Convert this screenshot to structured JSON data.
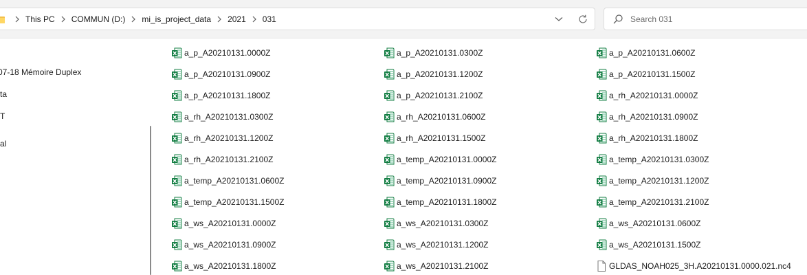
{
  "breadcrumb": {
    "items": [
      "This PC",
      "COMMUN (D:)",
      "mi_is_project_data",
      "2021",
      "031"
    ]
  },
  "search": {
    "placeholder": "Search 031"
  },
  "navpane": {
    "items": [
      "07-18 Mémoire Duplex",
      "ta",
      "T",
      "al"
    ]
  },
  "files": [
    {
      "name": "a_p_A20210131.0000Z",
      "type": "excel"
    },
    {
      "name": "a_p_A20210131.0300Z",
      "type": "excel"
    },
    {
      "name": "a_p_A20210131.0600Z",
      "type": "excel"
    },
    {
      "name": "a_p_A20210131.0900Z",
      "type": "excel"
    },
    {
      "name": "a_p_A20210131.1200Z",
      "type": "excel"
    },
    {
      "name": "a_p_A20210131.1500Z",
      "type": "excel"
    },
    {
      "name": "a_p_A20210131.1800Z",
      "type": "excel"
    },
    {
      "name": "a_p_A20210131.2100Z",
      "type": "excel"
    },
    {
      "name": "a_rh_A20210131.0000Z",
      "type": "excel"
    },
    {
      "name": "a_rh_A20210131.0300Z",
      "type": "excel"
    },
    {
      "name": "a_rh_A20210131.0600Z",
      "type": "excel"
    },
    {
      "name": "a_rh_A20210131.0900Z",
      "type": "excel"
    },
    {
      "name": "a_rh_A20210131.1200Z",
      "type": "excel"
    },
    {
      "name": "a_rh_A20210131.1500Z",
      "type": "excel"
    },
    {
      "name": "a_rh_A20210131.1800Z",
      "type": "excel"
    },
    {
      "name": "a_rh_A20210131.2100Z",
      "type": "excel"
    },
    {
      "name": "a_temp_A20210131.0000Z",
      "type": "excel"
    },
    {
      "name": "a_temp_A20210131.0300Z",
      "type": "excel"
    },
    {
      "name": "a_temp_A20210131.0600Z",
      "type": "excel"
    },
    {
      "name": "a_temp_A20210131.0900Z",
      "type": "excel"
    },
    {
      "name": "a_temp_A20210131.1200Z",
      "type": "excel"
    },
    {
      "name": "a_temp_A20210131.1500Z",
      "type": "excel"
    },
    {
      "name": "a_temp_A20210131.1800Z",
      "type": "excel"
    },
    {
      "name": "a_temp_A20210131.2100Z",
      "type": "excel"
    },
    {
      "name": "a_ws_A20210131.0000Z",
      "type": "excel"
    },
    {
      "name": "a_ws_A20210131.0300Z",
      "type": "excel"
    },
    {
      "name": "a_ws_A20210131.0600Z",
      "type": "excel"
    },
    {
      "name": "a_ws_A20210131.0900Z",
      "type": "excel"
    },
    {
      "name": "a_ws_A20210131.1200Z",
      "type": "excel"
    },
    {
      "name": "a_ws_A20210131.1500Z",
      "type": "excel"
    },
    {
      "name": "a_ws_A20210131.1800Z",
      "type": "excel"
    },
    {
      "name": "a_ws_A20210131.2100Z",
      "type": "excel"
    },
    {
      "name": "GLDAS_NOAH025_3H.A20210131.0000.021.nc4",
      "type": "generic"
    }
  ],
  "colors": {
    "excel_green": "#107c41",
    "folder_yellow": "#f3c04c"
  },
  "icons": {
    "excel": "excel-file-icon",
    "generic": "document-file-icon",
    "folder": "folder-icon",
    "search": "search-icon",
    "refresh": "refresh-icon",
    "dropdown": "chevron-down-icon",
    "separator": "chevron-right-icon"
  }
}
